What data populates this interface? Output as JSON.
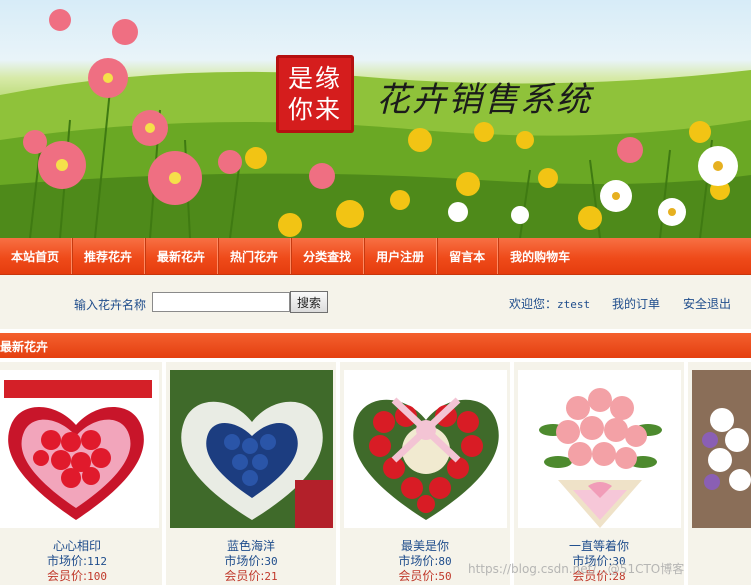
{
  "banner": {
    "seal_text": "是缘你来",
    "title": "花卉销售系统"
  },
  "nav": {
    "items": [
      "本站首页",
      "推荐花卉",
      "最新花卉",
      "热门花卉",
      "分类查找",
      "用户注册",
      "留言本",
      "我的购物车"
    ]
  },
  "search": {
    "label": "输入花卉名称",
    "value": "",
    "button": "搜索"
  },
  "user": {
    "welcome": "欢迎您：",
    "username": "ztest",
    "orders": "我的订单",
    "logout": "安全退出"
  },
  "section": {
    "title": "最新花卉"
  },
  "products": [
    {
      "name": "心心相印",
      "market_label": "市场价:",
      "market_price": "112",
      "member_label": "会员价:",
      "member_price": "100"
    },
    {
      "name": "蓝色海洋",
      "market_label": "市场价:",
      "market_price": "30",
      "member_label": "会员价:",
      "member_price": "21"
    },
    {
      "name": "最美是你",
      "market_label": "市场价:",
      "market_price": "80",
      "member_label": "会员价:",
      "member_price": "50"
    },
    {
      "name": "一直等着你",
      "market_label": "市场价:",
      "market_price": "30",
      "member_label": "会员价:",
      "member_price": "28"
    }
  ],
  "watermark": "https://blog.csdn.net/...@51CTO博客",
  "colors": {
    "nav_orange": "#ef4b1a",
    "link_blue": "#1f4d8c",
    "price_red": "#c0392b",
    "panel_bg": "#f5f3ea"
  }
}
